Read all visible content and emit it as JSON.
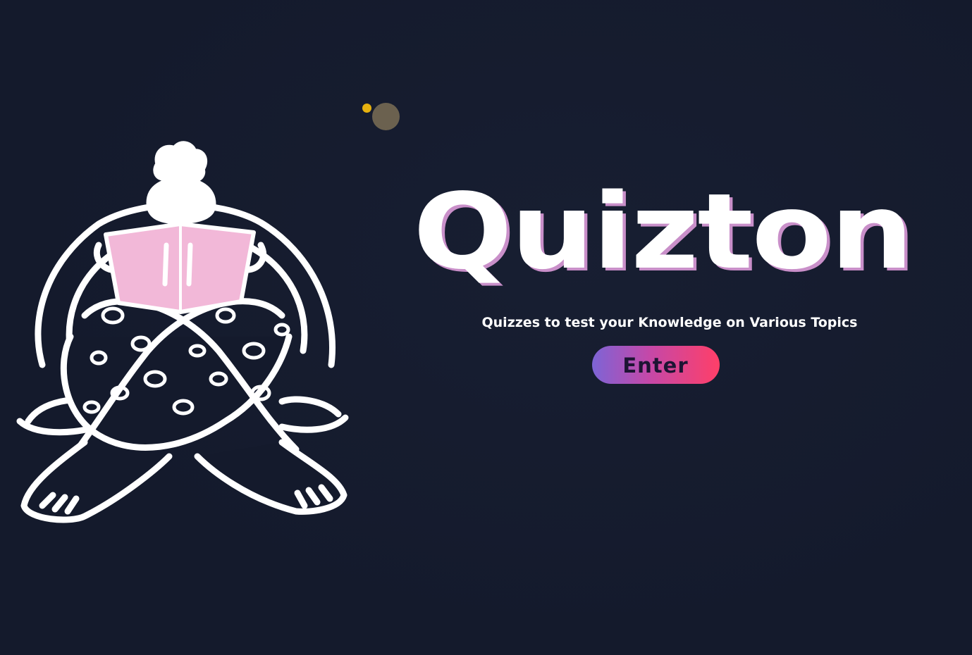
{
  "brand": {
    "title": "Quizton",
    "tagline": "Quizzes to test your Knowledge on Various Topics"
  },
  "actions": {
    "enter_label": "Enter"
  },
  "illustration": {
    "icon": "person-reading-book-illustration"
  },
  "colors": {
    "background": "#141a2c",
    "title_text": "#ffffff",
    "title_shadow": "#c98fc9",
    "button_gradient_start": "#7d64d6",
    "button_gradient_end": "#ff3f68",
    "book": "#f2b8d8",
    "cursor_dot": "#e6b10f"
  }
}
